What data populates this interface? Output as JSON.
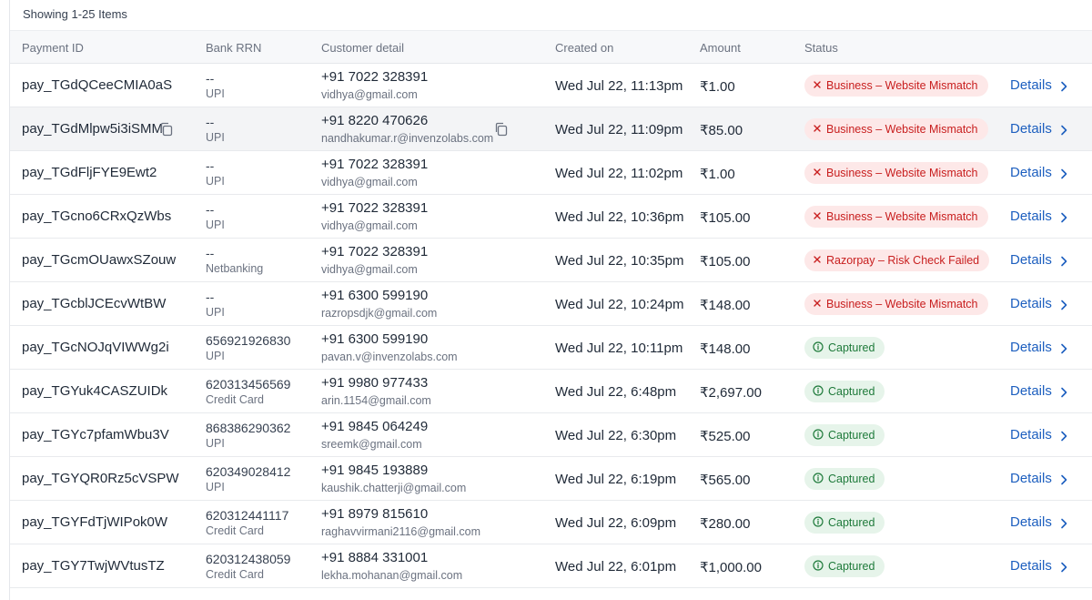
{
  "summary": "Showing 1-25 Items",
  "columns": [
    "Payment ID",
    "Bank RRN",
    "Customer detail",
    "Created on",
    "Amount",
    "Status"
  ],
  "details_label": "Details",
  "colors": {
    "link": "#1d5fbf",
    "fail_bg": "#fde8e8",
    "fail_text": "#c81e1e",
    "ok_bg": "#e6f4ea",
    "ok_text": "#1e7a3a"
  },
  "rows": [
    {
      "payment_id": "pay_TGdQCeeCMIA0aS",
      "rrn": "--",
      "method": "UPI",
      "phone": "+91 7022 328391",
      "email": "vidhya@gmail.com",
      "created": "Wed Jul 22, 11:13pm",
      "amount": "₹1.00",
      "status": "Business – Website Mismatch",
      "status_type": "fail"
    },
    {
      "payment_id": "pay_TGdMlpw5i3iSMM",
      "rrn": "--",
      "method": "UPI",
      "phone": "+91 8220 470626",
      "email": "nandhakumar.r@invenzolabs.com",
      "created": "Wed Jul 22, 11:09pm",
      "amount": "₹85.00",
      "status": "Business – Website Mismatch",
      "status_type": "fail"
    },
    {
      "payment_id": "pay_TGdFljFYE9Ewt2",
      "rrn": "--",
      "method": "UPI",
      "phone": "+91 7022 328391",
      "email": "vidhya@gmail.com",
      "created": "Wed Jul 22, 11:02pm",
      "amount": "₹1.00",
      "status": "Business – Website Mismatch",
      "status_type": "fail"
    },
    {
      "payment_id": "pay_TGcno6CRxQzWbs",
      "rrn": "--",
      "method": "UPI",
      "phone": "+91 7022 328391",
      "email": "vidhya@gmail.com",
      "created": "Wed Jul 22, 10:36pm",
      "amount": "₹105.00",
      "status": "Business – Website Mismatch",
      "status_type": "fail"
    },
    {
      "payment_id": "pay_TGcmOUawxSZouw",
      "rrn": "--",
      "method": "Netbanking",
      "phone": "+91 7022 328391",
      "email": "vidhya@gmail.com",
      "created": "Wed Jul 22, 10:35pm",
      "amount": "₹105.00",
      "status": "Razorpay – Risk Check Failed",
      "status_type": "fail"
    },
    {
      "payment_id": "pay_TGcblJCEcvWtBW",
      "rrn": "--",
      "method": "UPI",
      "phone": "+91 6300 599190",
      "email": "razropsdjk@gmail.com",
      "created": "Wed Jul 22, 10:24pm",
      "amount": "₹148.00",
      "status": "Business – Website Mismatch",
      "status_type": "fail"
    },
    {
      "payment_id": "pay_TGcNOJqVIWWg2i",
      "rrn": "656921926830",
      "method": "UPI",
      "phone": "+91 6300 599190",
      "email": "pavan.v@invenzolabs.com",
      "created": "Wed Jul 22, 10:11pm",
      "amount": "₹148.00",
      "status": "Captured",
      "status_type": "ok"
    },
    {
      "payment_id": "pay_TGYuk4CASZUIDk",
      "rrn": "620313456569",
      "method": "Credit Card",
      "phone": "+91 9980 977433",
      "email": "arin.1154@gmail.com",
      "created": "Wed Jul 22, 6:48pm",
      "amount": "₹2,697.00",
      "status": "Captured",
      "status_type": "ok"
    },
    {
      "payment_id": "pay_TGYc7pfamWbu3V",
      "rrn": "868386290362",
      "method": "UPI",
      "phone": "+91 9845 064249",
      "email": "sreemk@gmail.com",
      "created": "Wed Jul 22, 6:30pm",
      "amount": "₹525.00",
      "status": "Captured",
      "status_type": "ok"
    },
    {
      "payment_id": "pay_TGYQR0Rz5cVSPW",
      "rrn": "620349028412",
      "method": "UPI",
      "phone": "+91 9845 193889",
      "email": "kaushik.chatterji@gmail.com",
      "created": "Wed Jul 22, 6:19pm",
      "amount": "₹565.00",
      "status": "Captured",
      "status_type": "ok"
    },
    {
      "payment_id": "pay_TGYFdTjWIPok0W",
      "rrn": "620312441117",
      "method": "Credit Card",
      "phone": "+91 8979 815610",
      "email": "raghavvirmani2116@gmail.com",
      "created": "Wed Jul 22, 6:09pm",
      "amount": "₹280.00",
      "status": "Captured",
      "status_type": "ok"
    },
    {
      "payment_id": "pay_TGY7TwjWVtusTZ",
      "rrn": "620312438059",
      "method": "Credit Card",
      "phone": "+91 8884 331001",
      "email": "lekha.mohanan@gmail.com",
      "created": "Wed Jul 22, 6:01pm",
      "amount": "₹1,000.00",
      "status": "Captured",
      "status_type": "ok"
    }
  ]
}
